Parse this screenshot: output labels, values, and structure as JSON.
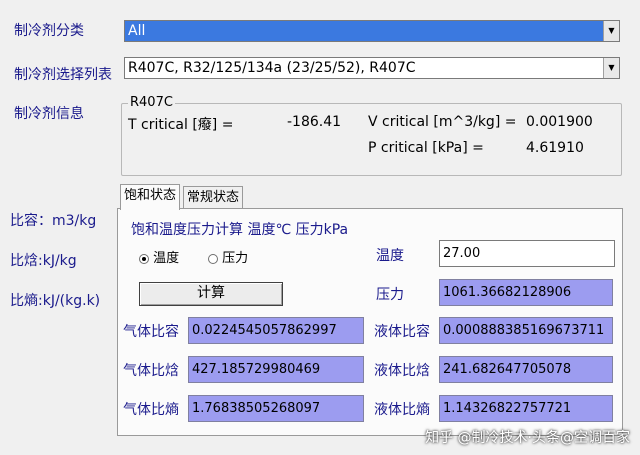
{
  "labels": {
    "category": "制冷剂分类",
    "select_list": "制冷剂选择列表",
    "info": "制冷剂信息",
    "specific_volume": "比容：m3/kg",
    "enthalpy": "比焓:kJ/kg",
    "entropy": "比熵:kJ/(kg.k)"
  },
  "category_combo": {
    "value": "All"
  },
  "list_combo": {
    "value": "R407C, R32/125/134a (23/25/52), R407C"
  },
  "info_group": {
    "title": "R407C",
    "t_critical_label": "T critical [癈] =",
    "t_critical_value": "-186.41",
    "v_critical_label": "V critical [m^3/kg] =",
    "v_critical_value": "0.001900",
    "p_critical_label": "P critical [kPa] =",
    "p_critical_value": "4.61910"
  },
  "tabs": [
    {
      "label": "饱和状态"
    },
    {
      "label": "常规状态"
    }
  ],
  "panel": {
    "heading": "饱和温度压力计算  温度℃  压力kPa",
    "radio_temp": "温度",
    "radio_pressure": "压力",
    "calc_button": "计算",
    "temp_label": "温度",
    "temp_value": "27.00",
    "pressure_label": "压力",
    "pressure_value": "1061.36682128906",
    "gas_sv_label": "气体比容",
    "gas_sv_value": "0.0224545057862997",
    "liq_sv_label": "液体比容",
    "liq_sv_value": "0.000888385169673711",
    "gas_h_label": "气体比焓",
    "gas_h_value": "427.185729980469",
    "liq_h_label": "液体比焓",
    "liq_h_value": "241.682647705078",
    "gas_s_label": "气体比熵",
    "gas_s_value": "1.76838505268097",
    "liq_s_label": "液体比熵",
    "liq_s_value": "1.14326822757721"
  },
  "watermark": "知乎 @制冷技术·头条@空调百家"
}
